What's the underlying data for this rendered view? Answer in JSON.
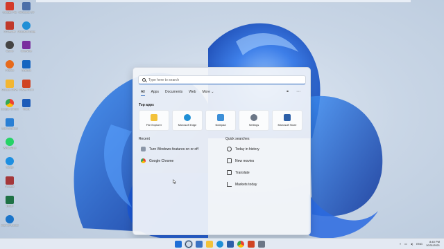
{
  "desktop": {
    "icons": [
      {
        "label": "Google File",
        "color": "#d33b2c"
      },
      {
        "label": "Windows CV",
        "color": "#4b6ea8"
      },
      {
        "label": "CCleaner",
        "color": "#c0392b"
      },
      {
        "label": "Microsoft Edge",
        "color": "#1f8fd6"
      },
      {
        "label": "Camo",
        "color": "#444"
      },
      {
        "label": "OneNote",
        "color": "#7a2f9e"
      },
      {
        "label": "Firefox",
        "color": "#e66a1c"
      },
      {
        "label": "Outlook",
        "color": "#1565c0"
      },
      {
        "label": "Google Drive",
        "color": "#f2b632"
      },
      {
        "label": "PowerPoint",
        "color": "#d04423"
      },
      {
        "label": "Google Chrome",
        "color": "#34a853"
      },
      {
        "label": "Word",
        "color": "#1d5bb8"
      },
      {
        "label": "Edit Shortcut",
        "color": "#2a7fd4"
      },
      {
        "label": "WhatsApp",
        "color": "#25d366"
      },
      {
        "label": "Skype",
        "color": "#1d8fe1"
      },
      {
        "label": "Access",
        "color": "#a4373a"
      },
      {
        "label": "Excel",
        "color": "#1e7145"
      },
      {
        "label": "Internet Explorer",
        "color": "#1a74c9"
      }
    ]
  },
  "search": {
    "placeholder": "Type here to search"
  },
  "tabs": [
    {
      "label": "All"
    },
    {
      "label": "Apps"
    },
    {
      "label": "Documents"
    },
    {
      "label": "Web"
    },
    {
      "label": "More ⌄"
    }
  ],
  "top_apps": {
    "title": "Top apps",
    "items": [
      {
        "label": "File Explorer",
        "color": "#f3c23a"
      },
      {
        "label": "Microsoft Edge",
        "color": "#1f8fd6"
      },
      {
        "label": "Notepad",
        "color": "#3c8fd8"
      },
      {
        "label": "Settings",
        "color": "#6b7686"
      },
      {
        "label": "Microsoft Store",
        "color": "#2c5fa8"
      }
    ]
  },
  "recent": {
    "title": "Recent",
    "items": [
      {
        "label": "Turn Windows features on or off",
        "color": "#8a96a8"
      },
      {
        "label": "Google Chrome",
        "color": "#e8453c"
      }
    ]
  },
  "quick_searches": {
    "title": "Quick searches",
    "items": [
      {
        "label": "Today in history",
        "icon": "clock-icon"
      },
      {
        "label": "New movies",
        "icon": "film-icon"
      },
      {
        "label": "Translate",
        "icon": "translate-icon"
      },
      {
        "label": "Markets today",
        "icon": "chart-icon"
      }
    ]
  },
  "taskbar": {
    "language": "ENG",
    "time": "8:40 PM",
    "date": "10/31/2021",
    "icons": [
      {
        "color": "#1f6fd6"
      },
      {
        "color": "#2e3b4c"
      },
      {
        "color": "#3b73c4"
      },
      {
        "color": "#f3c23a"
      },
      {
        "color": "#1f8fd6"
      },
      {
        "color": "#2c5fa8"
      },
      {
        "color": "#34a853"
      },
      {
        "color": "#d04423"
      },
      {
        "color": "#6b7686"
      }
    ]
  },
  "accent_color": "#1e5eb7"
}
